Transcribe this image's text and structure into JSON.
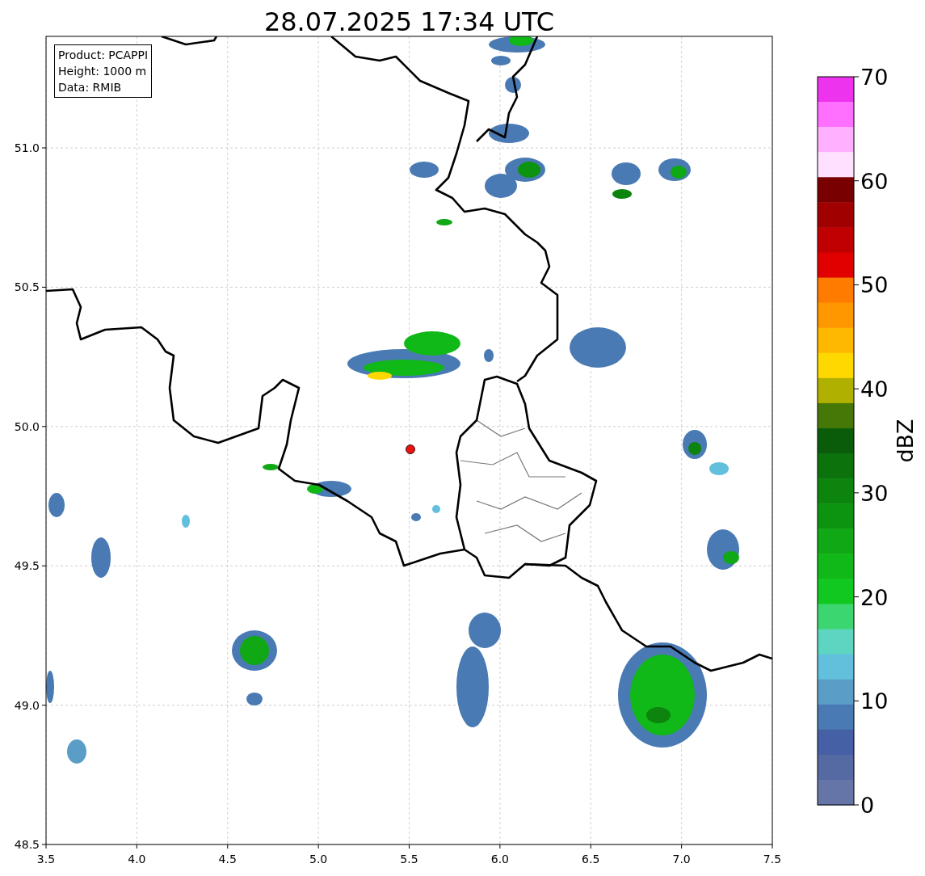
{
  "title": "28.07.2025 17:34 UTC",
  "map": {
    "info": [
      "Product: PCAPPI",
      "Height: 1000 m",
      "Data: RMIB"
    ],
    "grid": true,
    "x_ticks": [
      "3.5",
      "4.0",
      "4.5",
      "5.0",
      "5.5",
      "6.0",
      "6.5",
      "7.0",
      "7.5"
    ],
    "y_ticks": [
      "51.0",
      "50.5",
      "50.0",
      "49.5",
      "49.0",
      "48.5"
    ]
  },
  "colorbar": {
    "label": "dBZ",
    "ticks": [
      "70",
      "60",
      "50",
      "40",
      "30",
      "20",
      "10",
      "0"
    ],
    "segments": [
      {
        "color": "#ee33ee"
      },
      {
        "color": "#ff70ff"
      },
      {
        "color": "#ffb0ff"
      },
      {
        "color": "#ffe0ff"
      },
      {
        "color": "#780000"
      },
      {
        "color": "#a00000"
      },
      {
        "color": "#c00000"
      },
      {
        "color": "#e00000"
      },
      {
        "color": "#ff7c00"
      },
      {
        "color": "#ff9800"
      },
      {
        "color": "#ffb800"
      },
      {
        "color": "#ffd800"
      },
      {
        "color": "#b0b000"
      },
      {
        "color": "#467808"
      },
      {
        "color": "#0a5c0a"
      },
      {
        "color": "#0c720c"
      },
      {
        "color": "#0c840e"
      },
      {
        "color": "#0c9410"
      },
      {
        "color": "#10a814"
      },
      {
        "color": "#10b818"
      },
      {
        "color": "#10c820"
      },
      {
        "color": "#3cd670"
      },
      {
        "color": "#5ed5c0"
      },
      {
        "color": "#62c0dc"
      },
      {
        "color": "#5a9ec8"
      },
      {
        "color": "#4a7ab3"
      },
      {
        "color": "#4560a5"
      },
      {
        "color": "#5569a3"
      },
      {
        "color": "#6675a8"
      }
    ]
  }
}
